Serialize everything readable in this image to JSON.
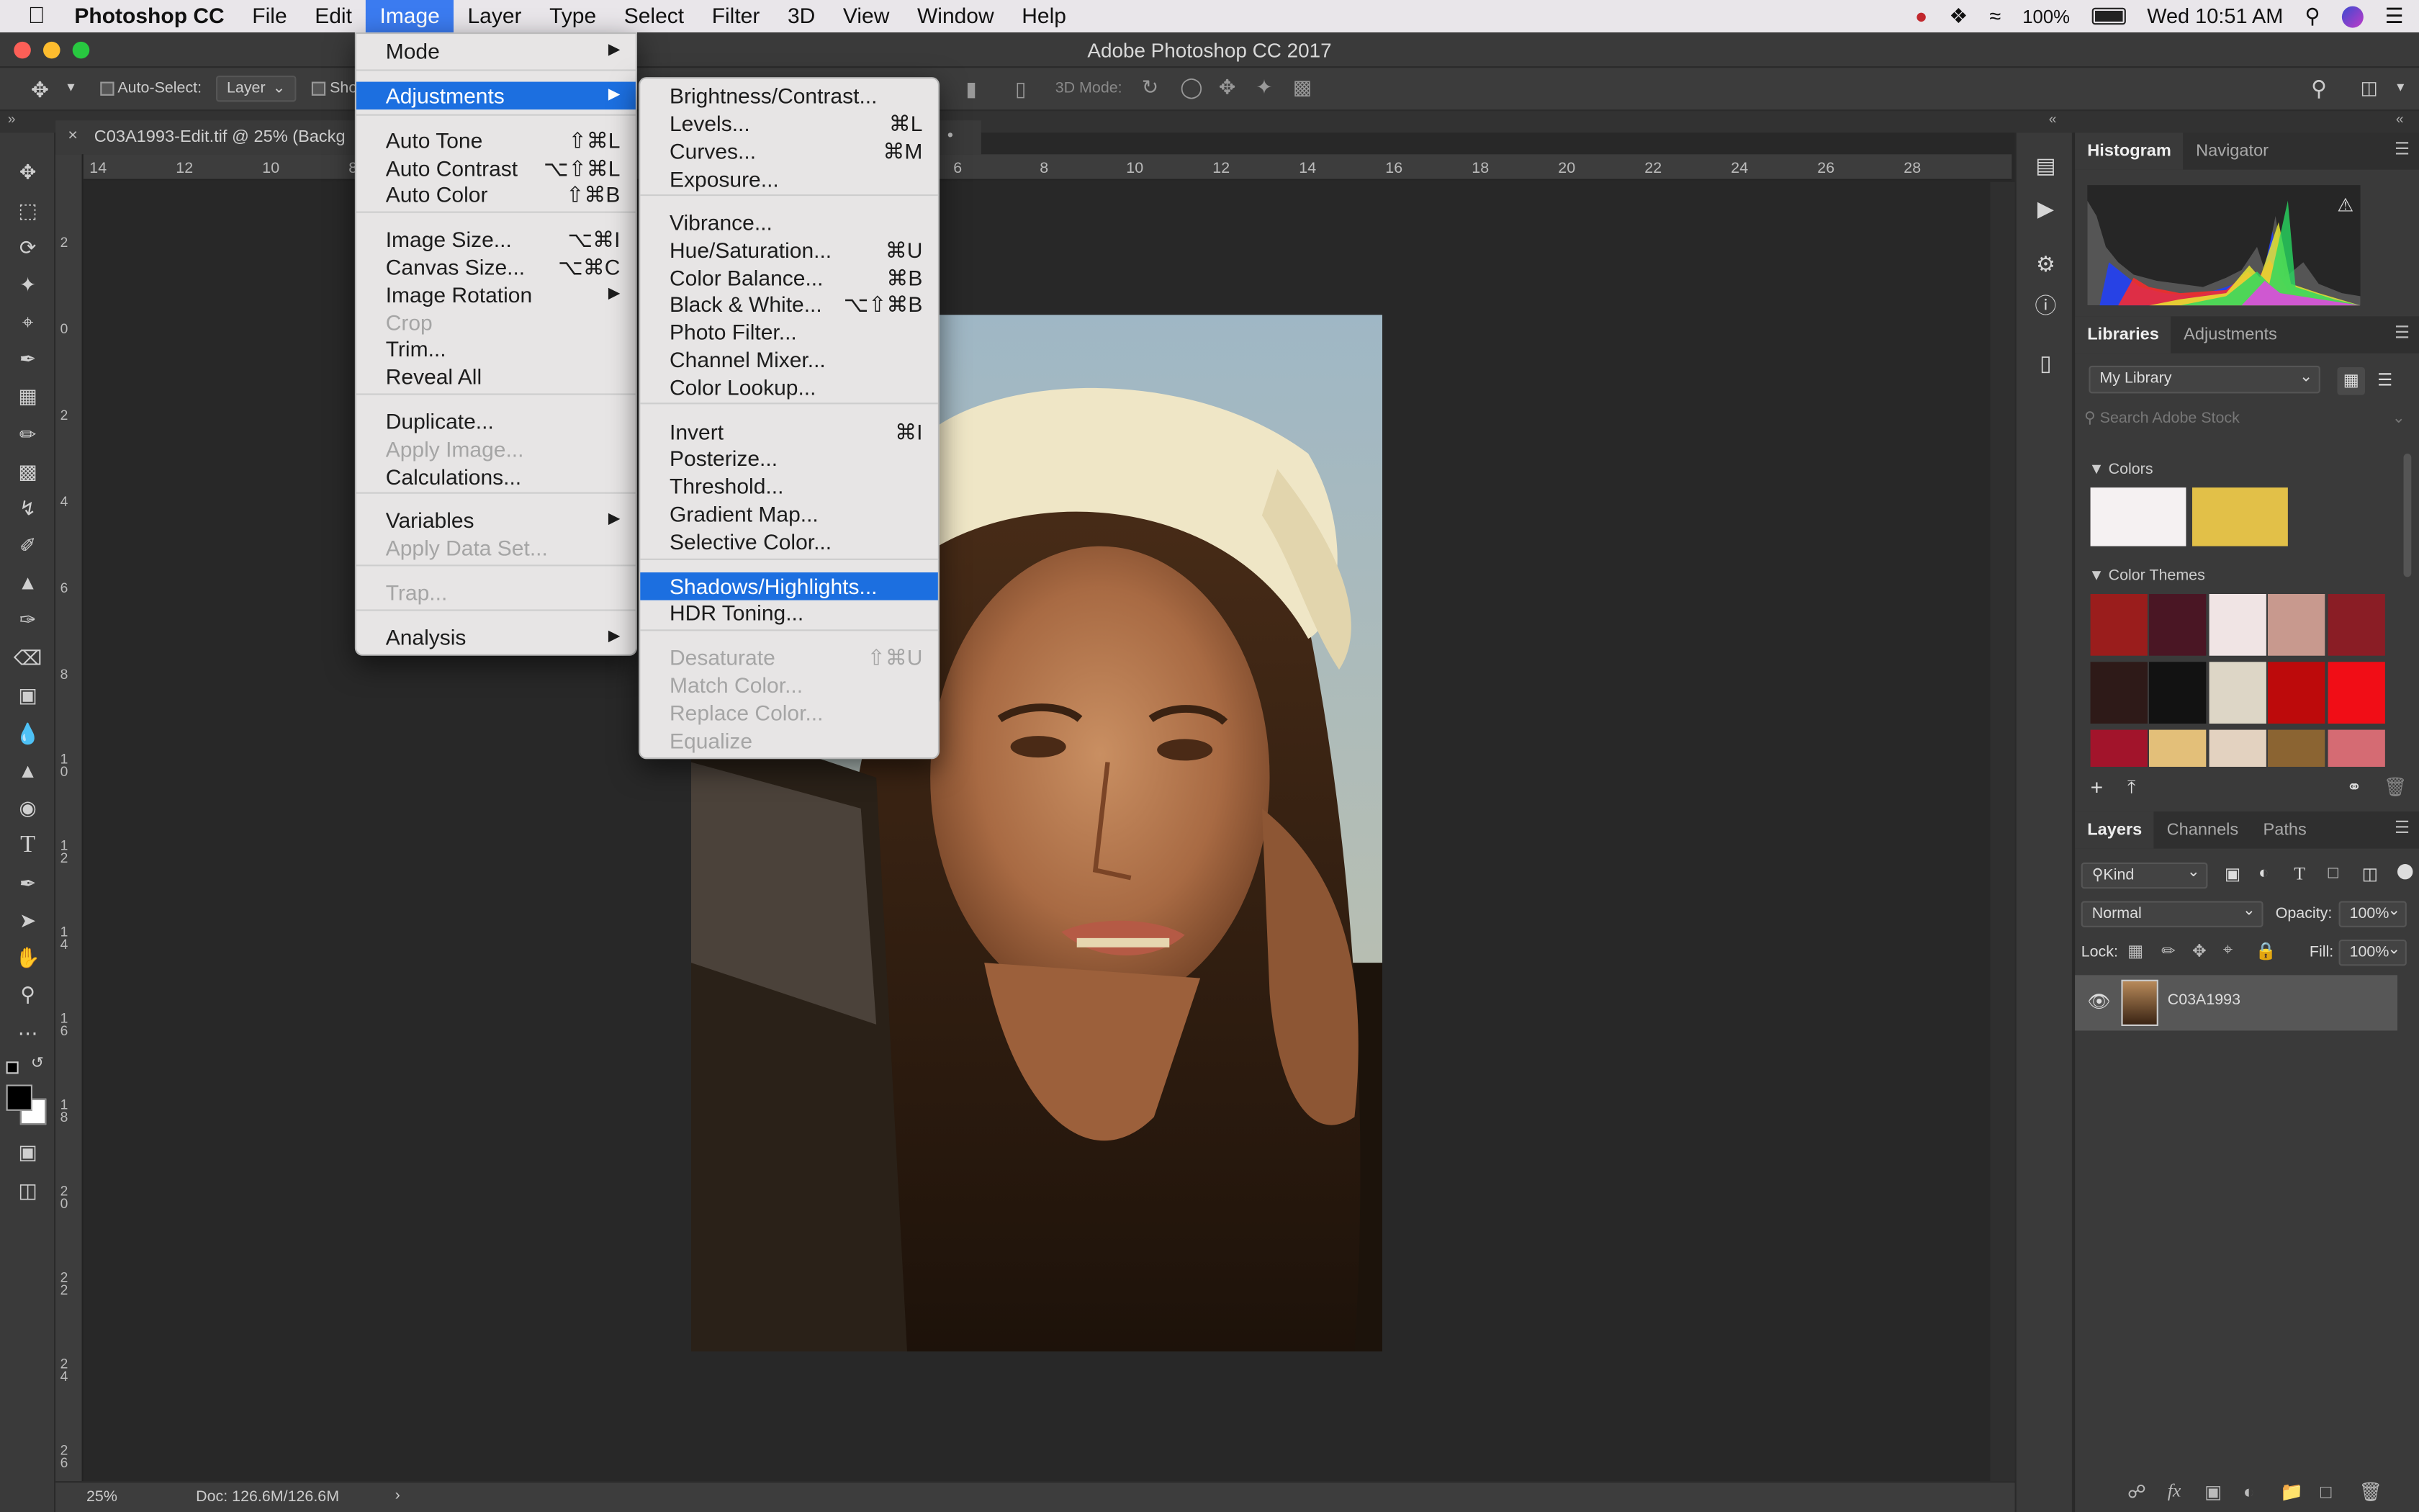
{
  "menubar": {
    "app": "Photoshop CC",
    "items": [
      "File",
      "Edit",
      "Image",
      "Layer",
      "Type",
      "Select",
      "Filter",
      "3D",
      "View",
      "Window",
      "Help"
    ],
    "active": "Image",
    "battery": "100%",
    "clock": "Wed 10:51 AM"
  },
  "window": {
    "title": "Adobe Photoshop CC 2017"
  },
  "options": {
    "auto_select": "Auto-Select:",
    "auto_select_value": "Layer",
    "show": "Sho",
    "mode3d": "3D Mode:"
  },
  "document": {
    "tab": "C03A1993-Edit.tif @ 25% (Backg",
    "zoom": "25%",
    "doc_size": "Doc: 126.6M/126.6M",
    "hruler": [
      "14",
      "12",
      "10",
      "8",
      "6",
      "8",
      "10",
      "12",
      "14",
      "16",
      "18",
      "20",
      "22",
      "24",
      "26",
      "28"
    ],
    "vruler": [
      "2",
      "0",
      "2",
      "4",
      "6",
      "8",
      "1 0",
      "1 2",
      "1 4",
      "1 6",
      "1 8",
      "2 0",
      "2 2",
      "2 4",
      "2 6"
    ]
  },
  "image_menu": {
    "items": [
      {
        "label": "Mode",
        "sub": true
      },
      {
        "label": "Adjustments",
        "sub": true,
        "highlight": true
      },
      {
        "label": "Auto Tone",
        "shortcut": "⇧⌘L"
      },
      {
        "label": "Auto Contrast",
        "shortcut": "⌥⇧⌘L"
      },
      {
        "label": "Auto Color",
        "shortcut": "⇧⌘B"
      },
      {
        "label": "Image Size...",
        "shortcut": "⌥⌘I"
      },
      {
        "label": "Canvas Size...",
        "shortcut": "⌥⌘C"
      },
      {
        "label": "Image Rotation",
        "sub": true
      },
      {
        "label": "Crop",
        "disabled": true
      },
      {
        "label": "Trim..."
      },
      {
        "label": "Reveal All"
      },
      {
        "label": "Duplicate..."
      },
      {
        "label": "Apply Image...",
        "disabled": true
      },
      {
        "label": "Calculations..."
      },
      {
        "label": "Variables",
        "sub": true
      },
      {
        "label": "Apply Data Set...",
        "disabled": true
      },
      {
        "label": "Trap...",
        "disabled": true
      },
      {
        "label": "Analysis",
        "sub": true
      }
    ]
  },
  "adjust_menu": {
    "items": [
      {
        "label": "Brightness/Contrast..."
      },
      {
        "label": "Levels...",
        "shortcut": "⌘L"
      },
      {
        "label": "Curves...",
        "shortcut": "⌘M"
      },
      {
        "label": "Exposure..."
      },
      {
        "label": "Vibrance..."
      },
      {
        "label": "Hue/Saturation...",
        "shortcut": "⌘U"
      },
      {
        "label": "Color Balance...",
        "shortcut": "⌘B"
      },
      {
        "label": "Black & White...",
        "shortcut": "⌥⇧⌘B"
      },
      {
        "label": "Photo Filter..."
      },
      {
        "label": "Channel Mixer..."
      },
      {
        "label": "Color Lookup..."
      },
      {
        "label": "Invert",
        "shortcut": "⌘I"
      },
      {
        "label": "Posterize..."
      },
      {
        "label": "Threshold..."
      },
      {
        "label": "Gradient Map..."
      },
      {
        "label": "Selective Color..."
      },
      {
        "label": "Shadows/Highlights...",
        "highlight": true
      },
      {
        "label": "HDR Toning..."
      },
      {
        "label": "Desaturate",
        "shortcut": "⇧⌘U",
        "disabled": true
      },
      {
        "label": "Match Color...",
        "disabled": true
      },
      {
        "label": "Replace Color...",
        "disabled": true
      },
      {
        "label": "Equalize",
        "disabled": true
      }
    ]
  },
  "panels": {
    "histogram_tabs": [
      "Histogram",
      "Navigator"
    ],
    "library_tabs": [
      "Libraries",
      "Adjustments"
    ],
    "library_select": "My Library",
    "search_placeholder": "Search Adobe Stock",
    "colors_label": "Colors",
    "colors": [
      "#f5f1f2",
      "#e2c048"
    ],
    "themes_label": "Color Themes",
    "themes": [
      [
        "#9a1d1c",
        "#4a1624",
        "#f0e4e4",
        "#c8998e",
        "#8a1d25"
      ],
      [
        "#2e1a18",
        "#121212",
        "#ddd6c6",
        "#bd0a0b",
        "#f10d16"
      ],
      [
        "#a2142b",
        "#e3bf79",
        "#e3d2c0",
        "#8b6432",
        "#d56b73"
      ]
    ],
    "layers_tabs": [
      "Layers",
      "Channels",
      "Paths"
    ],
    "kind": "Kind",
    "blend_mode": "Normal",
    "opacity_label": "Opacity:",
    "opacity": "100%",
    "lock_label": "Lock:",
    "fill_label": "Fill:",
    "fill": "100%",
    "layer_name": "C03A1993"
  }
}
